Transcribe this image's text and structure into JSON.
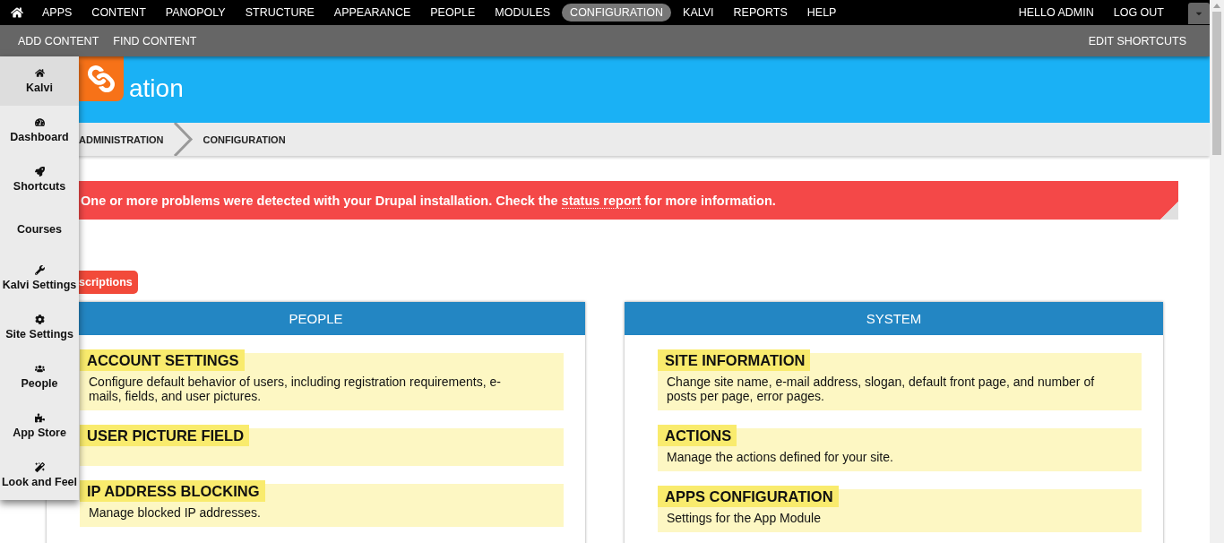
{
  "top_nav": {
    "items": [
      {
        "label": "APPS",
        "selected": false
      },
      {
        "label": "CONTENT",
        "selected": false
      },
      {
        "label": "PANOPOLY",
        "selected": false
      },
      {
        "label": "STRUCTURE",
        "selected": false
      },
      {
        "label": "APPEARANCE",
        "selected": false
      },
      {
        "label": "PEOPLE",
        "selected": false
      },
      {
        "label": "MODULES",
        "selected": false
      },
      {
        "label": "CONFIGURATION",
        "selected": true
      },
      {
        "label": "KALVI",
        "selected": false
      },
      {
        "label": "REPORTS",
        "selected": false
      },
      {
        "label": "HELP",
        "selected": false
      }
    ],
    "user": [
      "HELLO ADMIN",
      "LOG OUT"
    ]
  },
  "shortcuts": {
    "items": [
      "ADD CONTENT",
      "FIND CONTENT"
    ],
    "edit": "EDIT SHORTCUTS"
  },
  "sidebar": {
    "items": [
      {
        "label": "Kalvi",
        "selected": true
      },
      {
        "label": "Dashboard",
        "selected": false
      },
      {
        "label": "Shortcuts",
        "selected": false
      },
      {
        "label": "Courses",
        "selected": false
      },
      {
        "label": "Kalvi Settings",
        "selected": false
      },
      {
        "label": "Site Settings",
        "selected": false
      },
      {
        "label": "People",
        "selected": false
      },
      {
        "label": "App Store",
        "selected": false
      },
      {
        "label": "Look and Feel",
        "selected": false
      }
    ]
  },
  "page_title": "ation",
  "breadcrumb": [
    "ADMINISTRATION",
    "CONFIGURATION"
  ],
  "alert": {
    "before": "One or more problems were detected with your Drupal installation. Check the",
    "link": "status report",
    "after": "for more information."
  },
  "descriptions_button": "scriptions",
  "panels": [
    {
      "title": "PEOPLE",
      "items": [
        {
          "title": "ACCOUNT SETTINGS",
          "description": "Configure default behavior of users, including registration requirements, e-mails, fields, and user pictures."
        },
        {
          "title": "USER PICTURE FIELD"
        },
        {
          "title": "IP ADDRESS BLOCKING",
          "description": "Manage blocked IP addresses."
        }
      ]
    },
    {
      "title": "SYSTEM",
      "items": [
        {
          "title": "SITE INFORMATION",
          "description": "Change site name, e-mail address, slogan, default front page, and number of posts per page, error pages."
        },
        {
          "title": "ACTIONS",
          "description": "Manage the actions defined for your site."
        },
        {
          "title": "APPS CONFIGURATION",
          "description": "Settings for the App Module"
        }
      ]
    }
  ]
}
